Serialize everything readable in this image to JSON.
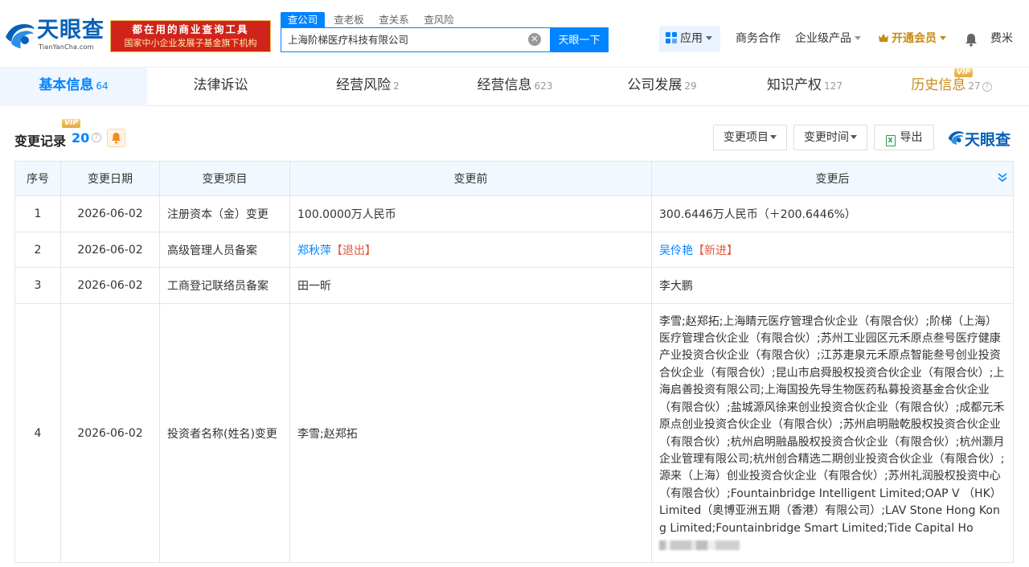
{
  "brand": {
    "name": "天眼查",
    "sub": "TianYanCha.com",
    "color": "#0a60b6"
  },
  "promo": {
    "line1": "都在用的商业查询工具",
    "line2": "国家中小企业发展子基金旗下机构"
  },
  "search": {
    "tabs": [
      "查公司",
      "查老板",
      "查关系",
      "查风险"
    ],
    "active_tab": 0,
    "value": "上海阶梯医疗科技有限公司",
    "button": "天眼一下"
  },
  "topnav": {
    "apps": "应用",
    "business": "商务合作",
    "enterprise": "企业级产品",
    "vip": "开通会员",
    "user": "费米"
  },
  "tabs": [
    {
      "label": "基本信息",
      "count": "64"
    },
    {
      "label": "法律诉讼",
      "count": ""
    },
    {
      "label": "经营风险",
      "count": "2"
    },
    {
      "label": "经营信息",
      "count": "623"
    },
    {
      "label": "公司发展",
      "count": "29"
    },
    {
      "label": "知识产权",
      "count": "127"
    },
    {
      "label": "历史信息",
      "count": "27"
    }
  ],
  "vip_label": "VIP",
  "section": {
    "title": "变更记录",
    "count": "20",
    "filter_item": "变更项目",
    "filter_time": "变更时间",
    "export": "导出"
  },
  "table": {
    "headers": [
      "序号",
      "变更日期",
      "变更项目",
      "变更前",
      "变更后"
    ],
    "rows": [
      {
        "idx": "1",
        "date": "2026-06-02",
        "item": "注册资本（金）变更",
        "before": "100.0000万人民币",
        "after": "300.6446万人民币（＋200.6446%）"
      },
      {
        "idx": "2",
        "date": "2026-06-02",
        "item": "高级管理人员备案",
        "before_name": "郑秋萍",
        "before_tag": "【退出】",
        "after_name": "吴伶艳",
        "after_tag": "【新进】"
      },
      {
        "idx": "3",
        "date": "2026-06-02",
        "item": "工商登记联络员备案",
        "before": "田一昕",
        "after": "李大鹏"
      },
      {
        "idx": "4",
        "date": "2026-06-02",
        "item": "投资者名称(姓名)变更",
        "before": "李雪;赵郑拓",
        "after": "李雪;赵郑拓;上海睛元医疗管理合伙企业（有限合伙）;阶梯（上海）医疗管理合伙企业（有限合伙）;苏州工业园区元禾原点叁号医疗健康产业投资合伙企业（有限合伙）;江苏疌泉元禾原点智能叁号创业投资合伙企业（有限合伙）;昆山市启舜股权投资合伙企业（有限合伙）;上海启善投资有限公司;上海国投先导生物医药私募投资基金合伙企业（有限合伙）;盐城源风徐来创业投资合伙企业（有限合伙）;成都元禾原点创业投资合伙企业（有限合伙）;苏州启明融乾股权投资合伙企业（有限合伙）;杭州启明融晶股权投资合伙企业（有限合伙）;杭州灏月企业管理有限公司;杭州创合精选二期创业投资合伙企业（有限合伙）;源来（上海）创业投资合伙企业（有限合伙）;苏州礼润股权投资中心（有限合伙）;Fountainbridge Intelligent Limited;OAP V （HK） Limited（奥博亚洲五期（香港）有限公司）;LAV Stone Hong Kong Limited;Fountainbridge Smart Limited;Tide Capital Ho"
      }
    ]
  },
  "colors": {
    "accent": "#0084ff",
    "vip": "#c88a14",
    "red": "#e25a3d"
  }
}
